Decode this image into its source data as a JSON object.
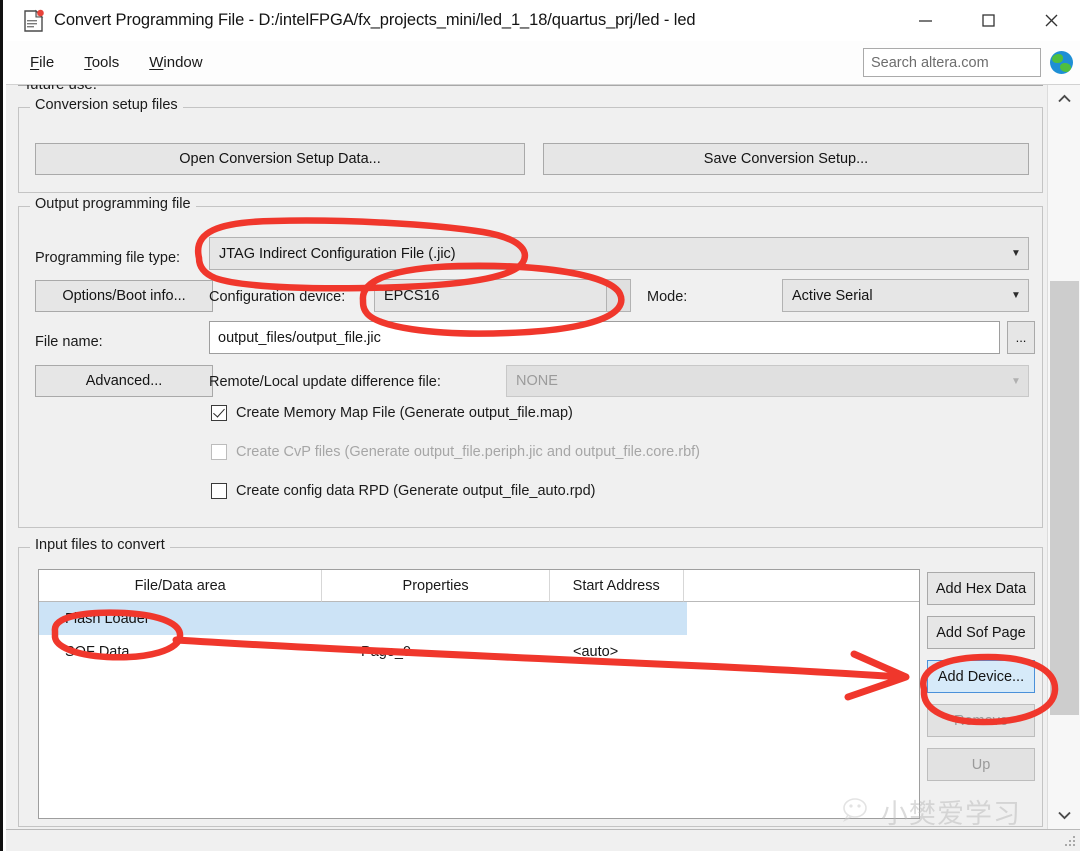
{
  "window": {
    "title": "Convert Programming File - D:/intelFPGA/fx_projects_mini/led_1_18/quartus_prj/led - led",
    "minimize_label": "Minimize",
    "maximize_label": "Maximize",
    "close_label": "Close"
  },
  "menubar": {
    "items": [
      {
        "accel": "F",
        "rest": "ile"
      },
      {
        "accel": "T",
        "rest": "ools"
      },
      {
        "accel": "W",
        "rest": "indow"
      }
    ]
  },
  "search": {
    "placeholder": "Search altera.com",
    "value": "",
    "globe_icon": "globe-icon"
  },
  "pane": {
    "cutoff_text": "future use."
  },
  "conversion_setup": {
    "legend": "Conversion setup files",
    "open_button": "Open Conversion Setup Data...",
    "save_button": "Save Conversion Setup..."
  },
  "output_file": {
    "legend": "Output programming file",
    "file_type_label": "Programming file type:",
    "file_type_value": "JTAG Indirect Configuration File (.jic)",
    "options_boot_button": "Options/Boot info...",
    "config_device_label": "Configuration device:",
    "config_device_value": "EPCS16",
    "mode_label": "Mode:",
    "mode_value": "Active Serial",
    "file_name_label": "File name:",
    "file_name_value": "output_files/output_file.jic",
    "browse_button": "...",
    "advanced_button": "Advanced...",
    "remote_local_label": "Remote/Local update difference file:",
    "remote_local_value": "NONE",
    "checkboxes": [
      {
        "label": "Create Memory Map File (Generate output_file.map)",
        "checked": true,
        "disabled": false
      },
      {
        "label": "Create CvP files (Generate output_file.periph.jic and output_file.core.rbf)",
        "checked": false,
        "disabled": true
      },
      {
        "label": "Create config data RPD (Generate output_file_auto.rpd)",
        "checked": false,
        "disabled": false
      }
    ]
  },
  "input_files": {
    "legend": "Input files to convert",
    "columns": [
      "File/Data area",
      "Properties",
      "Start Address"
    ],
    "rows": [
      {
        "file_data_area": "Flash Loader",
        "properties": "",
        "start_address": "",
        "selected": true
      },
      {
        "file_data_area": "SOF Data",
        "properties": "Page_0",
        "start_address": "<auto>",
        "selected": false
      }
    ],
    "buttons": [
      {
        "label": "Add Hex Data",
        "state": "normal"
      },
      {
        "label": "Add Sof Page",
        "state": "normal"
      },
      {
        "label": "Add Device...",
        "state": "hovered"
      },
      {
        "label": "Remove",
        "state": "disabled"
      },
      {
        "label": "Up",
        "state": "disabled"
      }
    ]
  },
  "scrollbar": {
    "up_label": "Scroll up",
    "down_label": "Scroll down"
  },
  "watermark": {
    "text": "小樊爱学习"
  },
  "annotations": {
    "color": "#f0372c",
    "items": [
      "ellipse-around-programming-file-type",
      "ellipse-around-configuration-device",
      "ellipse-around-flash-loader",
      "arrow-to-add-device",
      "ellipse-around-add-device"
    ]
  }
}
